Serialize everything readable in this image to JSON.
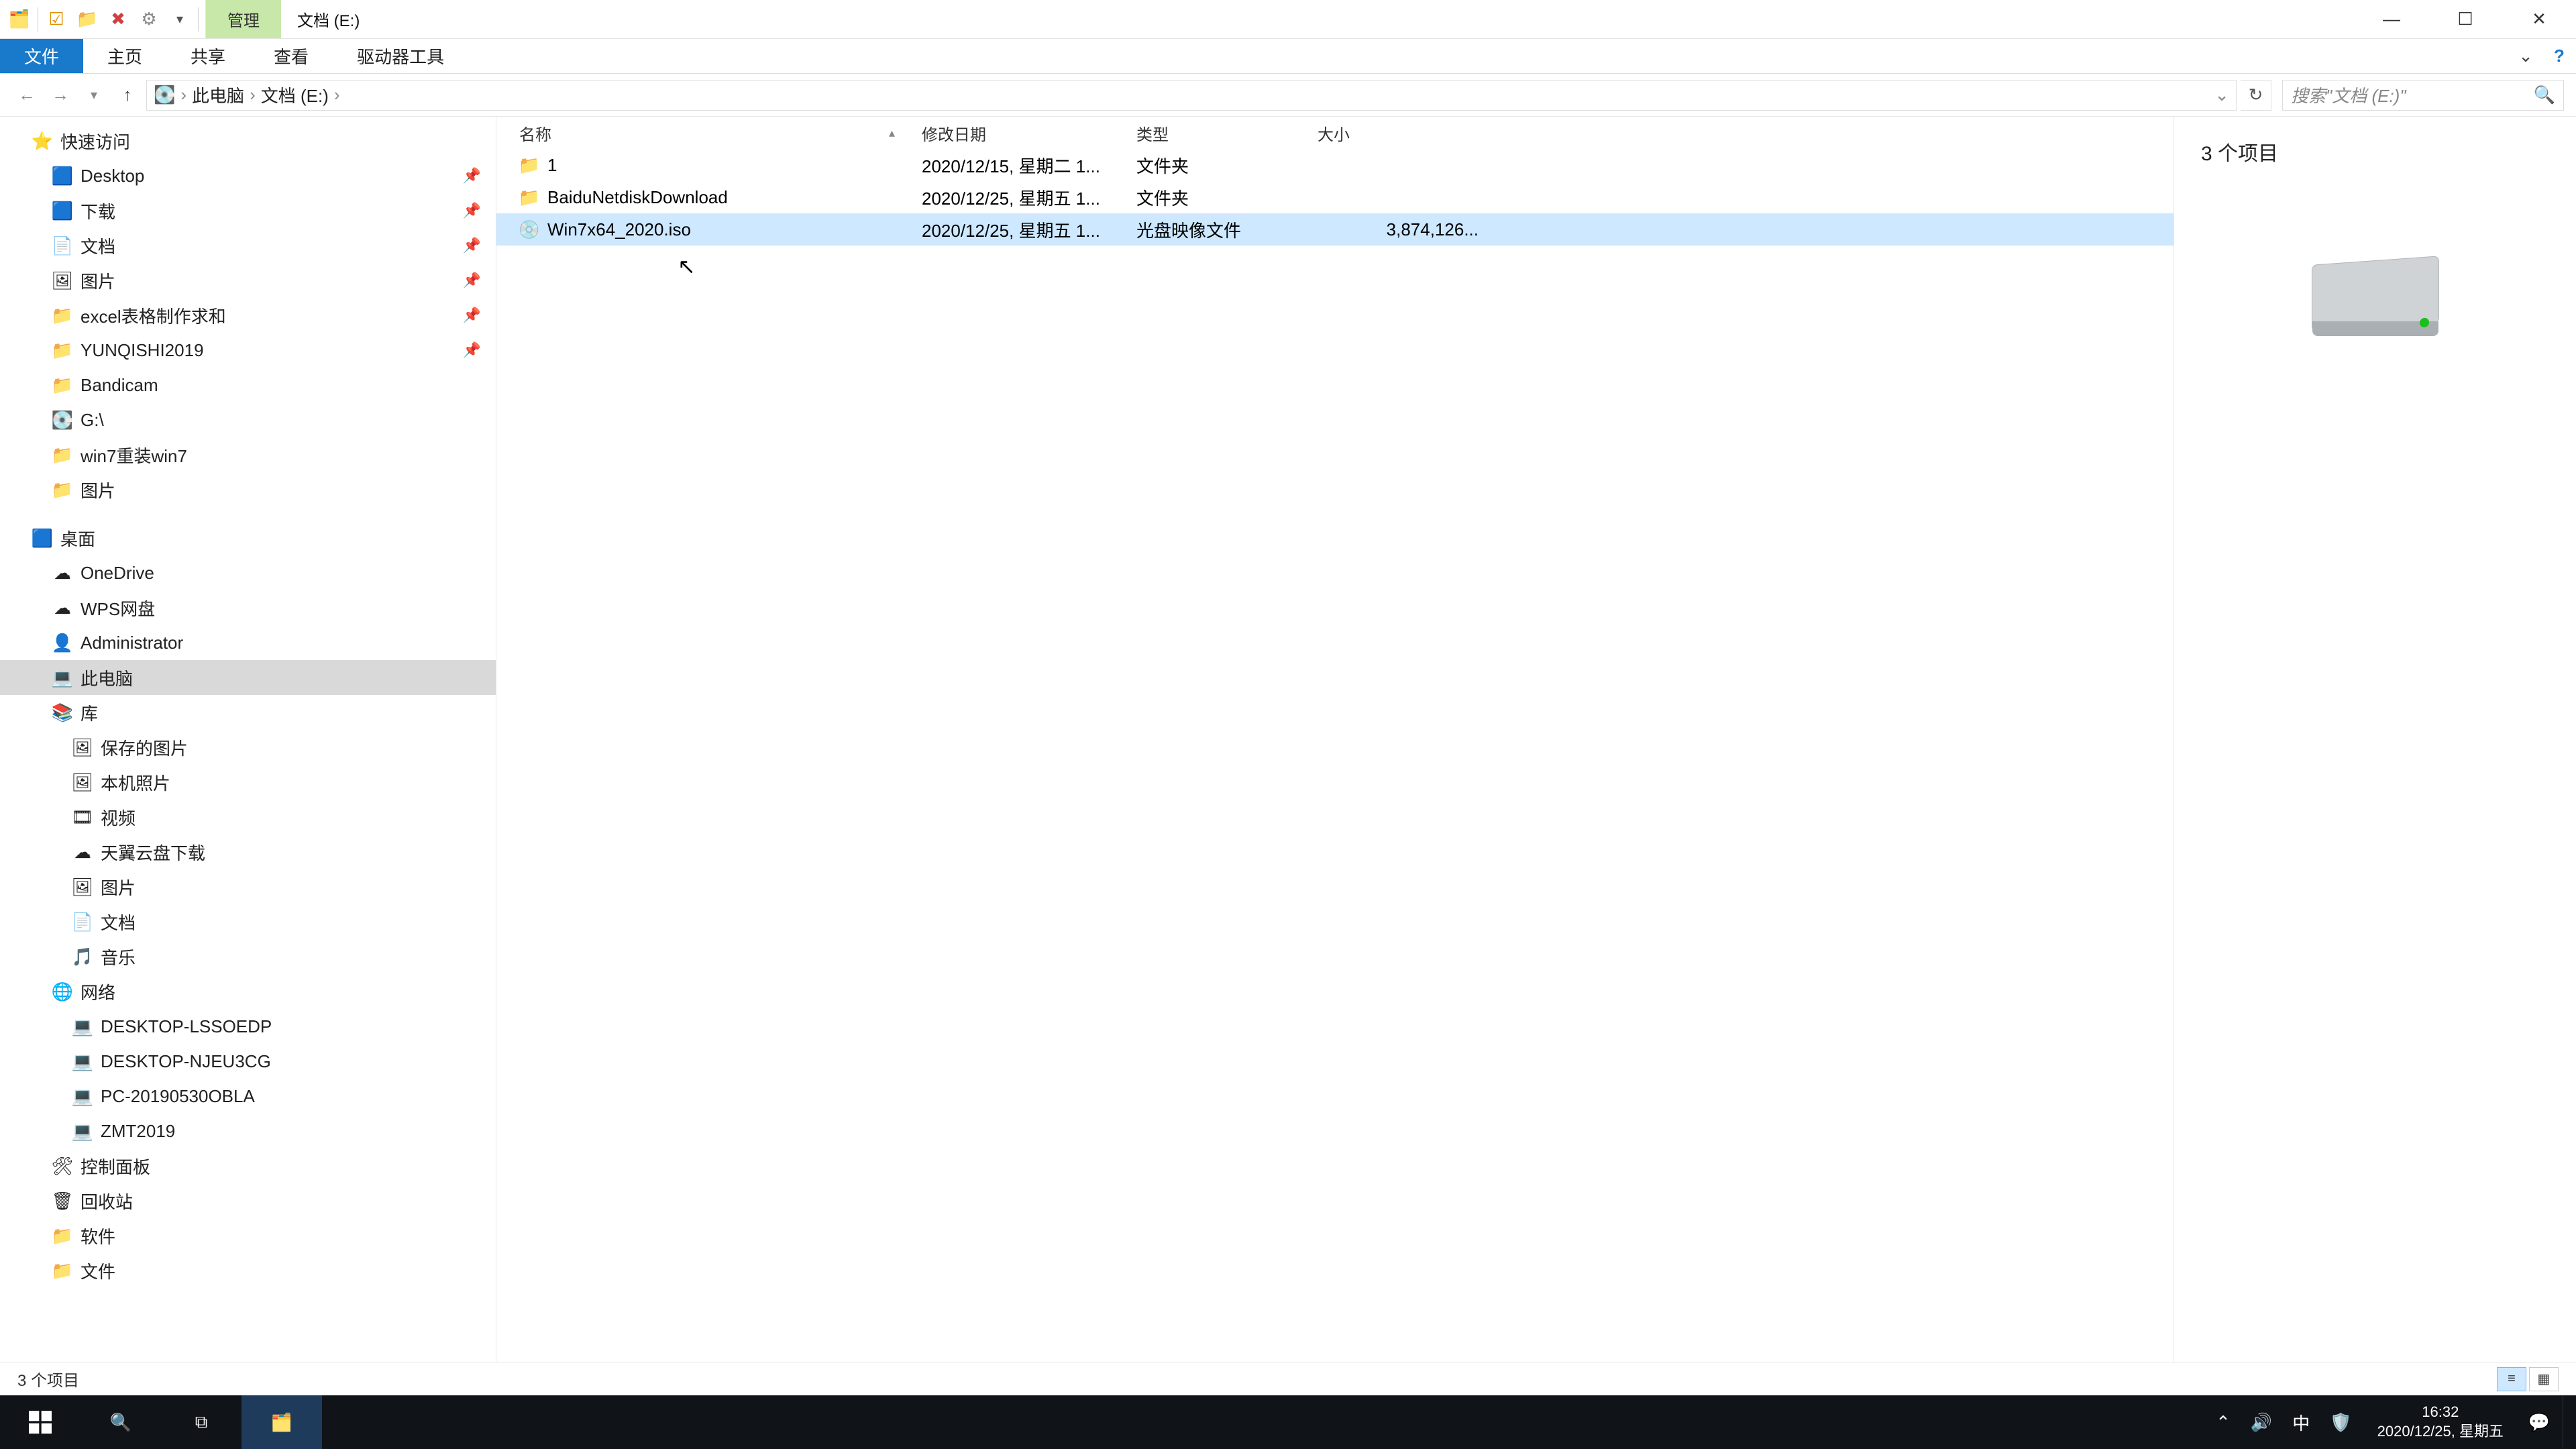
{
  "title_bar": {
    "contextual_tab": "管理",
    "window_title": "文档 (E:)"
  },
  "ribbon": {
    "file": "文件",
    "tabs": [
      "主页",
      "共享",
      "查看"
    ],
    "contextual": "驱动器工具"
  },
  "address": {
    "crumbs": [
      "此电脑",
      "文档 (E:)"
    ],
    "search_placeholder": "搜索\"文档 (E:)\""
  },
  "columns": {
    "name": "名称",
    "date": "修改日期",
    "type": "类型",
    "size": "大小"
  },
  "rows": [
    {
      "icon": "📁",
      "name": "1",
      "date": "2020/12/15, 星期二 1...",
      "type": "文件夹",
      "size": "",
      "selected": false
    },
    {
      "icon": "📁",
      "name": "BaiduNetdiskDownload",
      "date": "2020/12/25, 星期五 1...",
      "type": "文件夹",
      "size": "",
      "selected": false
    },
    {
      "icon": "💿",
      "name": "Win7x64_2020.iso",
      "date": "2020/12/25, 星期五 1...",
      "type": "光盘映像文件",
      "size": "3,874,126...",
      "selected": true
    }
  ],
  "tree": {
    "quick_access": {
      "label": "快速访问",
      "icon": "⭐"
    },
    "quick_items": [
      {
        "label": "Desktop",
        "icon": "🟦",
        "pinned": true
      },
      {
        "label": "下载",
        "icon": "🟦",
        "pinned": true
      },
      {
        "label": "文档",
        "icon": "📄",
        "pinned": true
      },
      {
        "label": "图片",
        "icon": "🖼",
        "pinned": true
      },
      {
        "label": "excel表格制作求和",
        "icon": "📁",
        "pinned": true
      },
      {
        "label": "YUNQISHI2019",
        "icon": "📁",
        "pinned": true
      },
      {
        "label": "Bandicam",
        "icon": "📁",
        "pinned": false
      },
      {
        "label": "G:\\",
        "icon": "💽",
        "pinned": false
      },
      {
        "label": "win7重装win7",
        "icon": "📁",
        "pinned": false
      },
      {
        "label": "图片",
        "icon": "📁",
        "pinned": false
      }
    ],
    "desktop": {
      "label": "桌面",
      "icon": "🟦"
    },
    "desktop_items": [
      {
        "label": "OneDrive",
        "icon": "☁"
      },
      {
        "label": "WPS网盘",
        "icon": "☁"
      },
      {
        "label": "Administrator",
        "icon": "👤"
      },
      {
        "label": "此电脑",
        "icon": "💻",
        "selected": true
      },
      {
        "label": "库",
        "icon": "📚"
      }
    ],
    "library_items": [
      {
        "label": "保存的图片",
        "icon": "🖼"
      },
      {
        "label": "本机照片",
        "icon": "🖼"
      },
      {
        "label": "视频",
        "icon": "🎞"
      },
      {
        "label": "天翼云盘下载",
        "icon": "☁"
      },
      {
        "label": "图片",
        "icon": "🖼"
      },
      {
        "label": "文档",
        "icon": "📄"
      },
      {
        "label": "音乐",
        "icon": "🎵"
      }
    ],
    "network": {
      "label": "网络",
      "icon": "🌐"
    },
    "network_items": [
      {
        "label": "DESKTOP-LSSOEDP",
        "icon": "💻"
      },
      {
        "label": "DESKTOP-NJEU3CG",
        "icon": "💻"
      },
      {
        "label": "PC-20190530OBLA",
        "icon": "💻"
      },
      {
        "label": "ZMT2019",
        "icon": "💻"
      }
    ],
    "misc": [
      {
        "label": "控制面板",
        "icon": "🛠"
      },
      {
        "label": "回收站",
        "icon": "🗑"
      },
      {
        "label": "软件",
        "icon": "📁"
      },
      {
        "label": "文件",
        "icon": "📁"
      }
    ]
  },
  "preview": {
    "count_text": "3 个项目"
  },
  "status": {
    "text": "3 个项目"
  },
  "taskbar": {
    "time": "16:32",
    "date": "2020/12/25, 星期五",
    "ime": "中"
  }
}
